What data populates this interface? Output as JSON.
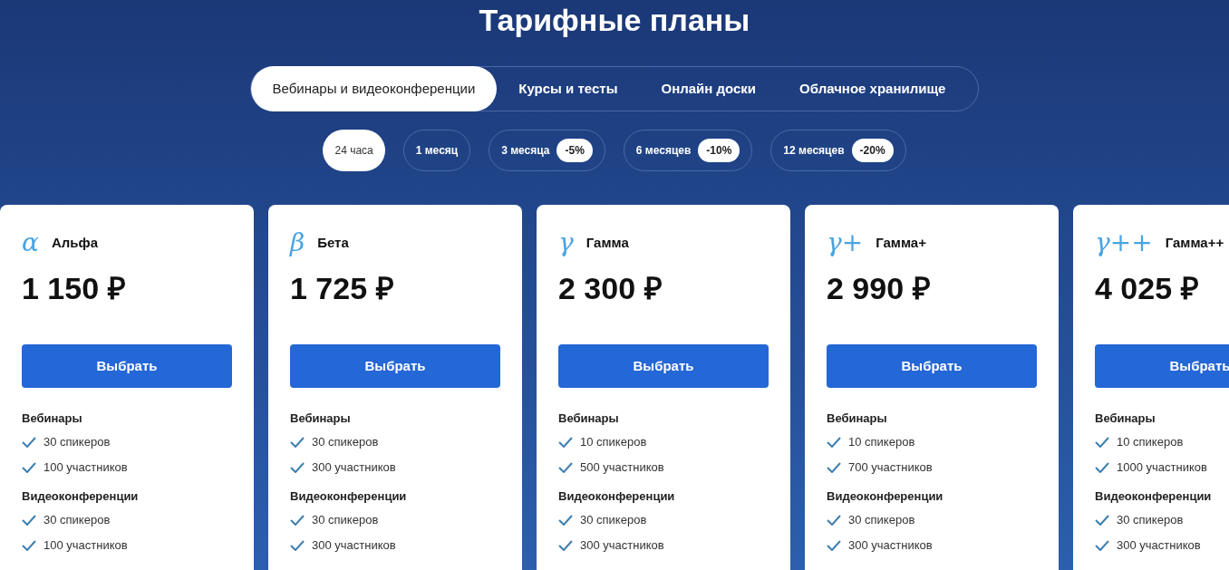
{
  "title": "Тарифные планы",
  "tabs": [
    {
      "label": "Вебинары и видеоконференции",
      "selected": true
    },
    {
      "label": "Курсы и тесты",
      "selected": false
    },
    {
      "label": "Онлайн доски",
      "selected": false
    },
    {
      "label": "Облачное хранилище",
      "selected": false
    }
  ],
  "periods": [
    {
      "label": "24 часа",
      "selected": true
    },
    {
      "label": "1 месяц",
      "selected": false
    },
    {
      "label": "3 месяца",
      "discount": "-5%",
      "selected": false
    },
    {
      "label": "6 месяцев",
      "discount": "-10%",
      "selected": false
    },
    {
      "label": "12 месяцев",
      "discount": "-20%",
      "selected": false
    }
  ],
  "plans": [
    {
      "symbol": "α",
      "name": "Альфа",
      "price": "1 150 ₽",
      "button": "Выбрать",
      "sections": [
        {
          "title": "Вебинары",
          "items": [
            "30 спикеров",
            "100 участников"
          ]
        },
        {
          "title": "Видеоконференции",
          "items": [
            "30 спикеров",
            "100 участников"
          ]
        }
      ]
    },
    {
      "symbol": "β",
      "name": "Бета",
      "price": "1 725 ₽",
      "button": "Выбрать",
      "sections": [
        {
          "title": "Вебинары",
          "items": [
            "30 спикеров",
            "300 участников"
          ]
        },
        {
          "title": "Видеоконференции",
          "items": [
            "30 спикеров",
            "300 участников"
          ]
        }
      ]
    },
    {
      "symbol": "γ",
      "name": "Гамма",
      "price": "2 300 ₽",
      "button": "Выбрать",
      "sections": [
        {
          "title": "Вебинары",
          "items": [
            "10 спикеров",
            "500 участников"
          ]
        },
        {
          "title": "Видеоконференции",
          "items": [
            "30 спикеров",
            "300 участников"
          ]
        }
      ]
    },
    {
      "symbol": "γ+",
      "name": "Гамма+",
      "price": "2 990 ₽",
      "button": "Выбрать",
      "sections": [
        {
          "title": "Вебинары",
          "items": [
            "10 спикеров",
            "700 участников"
          ]
        },
        {
          "title": "Видеоконференции",
          "items": [
            "30 спикеров",
            "300 участников"
          ]
        }
      ]
    },
    {
      "symbol": "γ++",
      "name": "Гамма++",
      "price": "4 025 ₽",
      "button": "Выбрать",
      "sections": [
        {
          "title": "Вебинары",
          "items": [
            "10 спикеров",
            "1000 участников"
          ]
        },
        {
          "title": "Видеоконференции",
          "items": [
            "30 спикеров",
            "300 участников"
          ]
        }
      ]
    }
  ]
}
